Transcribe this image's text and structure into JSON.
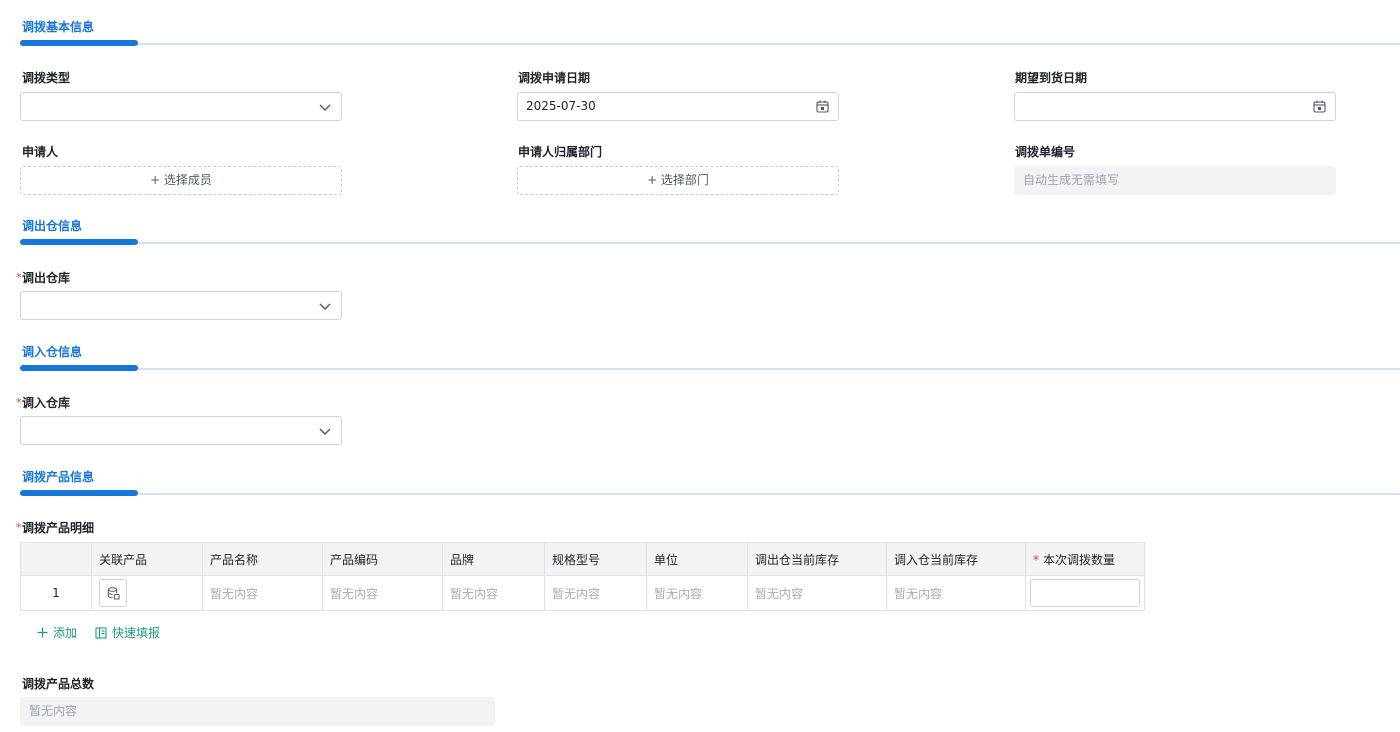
{
  "sections": {
    "basic": "调拨基本信息",
    "out": "调出仓信息",
    "in": "调入仓信息",
    "products": "调拨产品信息"
  },
  "basic": {
    "type_label": "调拨类型",
    "type_value": "",
    "apply_date_label": "调拨申请日期",
    "apply_date_value": "2025-07-30",
    "expect_date_label": "期望到货日期",
    "expect_date_value": "",
    "applicant_label": "申请人",
    "applicant_button": "+ 选择成员",
    "dept_label": "申请人归属部门",
    "dept_button": "+ 选择部门",
    "number_label": "调拨单编号",
    "number_placeholder": "自动生成无需填写"
  },
  "out": {
    "warehouse_label": "调出仓库",
    "warehouse_value": ""
  },
  "in": {
    "warehouse_label": "调入仓库",
    "warehouse_value": ""
  },
  "products": {
    "detail_label": "调拨产品明细",
    "columns": [
      "关联产品",
      "产品名称",
      "产品编码",
      "品牌",
      "规格型号",
      "单位",
      "调出仓当前库存",
      "调入仓当前库存",
      "本次调拨数量"
    ],
    "rows": [
      {
        "index": "1",
        "name": "暂无内容",
        "code": "暂无内容",
        "brand": "暂无内容",
        "spec": "暂无内容",
        "unit": "暂无内容",
        "out_stock": "暂无内容",
        "in_stock": "暂无内容",
        "qty": ""
      }
    ],
    "add_label": "添加",
    "quick_fill_label": "快速填报",
    "total_label": "调拨产品总数",
    "total_value": "暂无内容"
  },
  "colors": {
    "accent": "#1677d9",
    "action_green": "#1a9e7a",
    "required": "#e23c39"
  }
}
